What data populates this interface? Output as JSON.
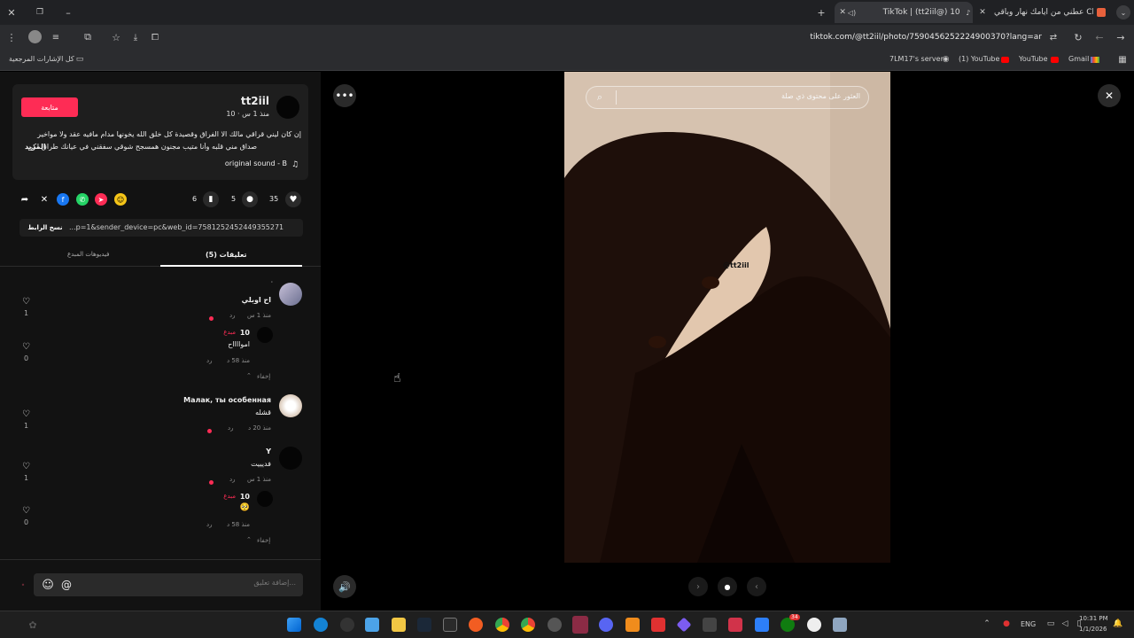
{
  "browser": {
    "tabs": [
      {
        "title": "عطني من أيامك نهار وباقي Cloud"
      },
      {
        "title": "TikTok | (tt2iil@) 10"
      }
    ],
    "url": "tiktok.com/@tt2iil/photo/7590456252224900370?lang=ar",
    "bookmarks": {
      "all_label": "كل الإشارات المرجعية",
      "items": [
        "7LM17's server",
        "(1) YouTube",
        "YouTube",
        "Gmail"
      ]
    }
  },
  "post": {
    "username": "tt2iil",
    "meta": "10 · منذ 1 س",
    "follow_label": "متابعة",
    "caption_line1": "إن كان ليني قراقي مالك الا الفراق وقصيدة كل خلق الله يخونها مدام مافيه عقد ولا مواخير",
    "caption_line2": "صداق مني قلبه وأنا متيب مجنون همسجح شوقي سفقني في عيانك طراق لكن لا...",
    "more_label": "المزيد",
    "sound": "original sound - B",
    "likes": "35",
    "comments": "5",
    "saves": "6",
    "copy_link_label": "نسخ الرابط",
    "link_text": "...p=1&sender_device=pc&web_id=7581252452449355271",
    "tab_comments": "(5) تعليقات",
    "tab_creator": "فيديوهات المبدع",
    "comment_placeholder": "إضافة تعليق..."
  },
  "comments": [
    {
      "name": "اح اوبلي",
      "mark": "٠",
      "time": "منذ 1 س",
      "reply": "رد",
      "likes": "1"
    },
    {
      "name": "10",
      "badge": "مبدع",
      "text": "اموااااح",
      "time": "منذ 58 د",
      "reply": "رد",
      "likes": "0"
    },
    {
      "hide": "إخفاء"
    },
    {
      "name": "Малак, ты особенная",
      "text": "قشله",
      "time": "منذ 20 د",
      "reply": "رد",
      "likes": "1"
    },
    {
      "name": "Y",
      "text": "فديييت",
      "time": "منذ 1 س",
      "reply": "رد",
      "likes": "1"
    },
    {
      "name": "10",
      "badge": "مبدع",
      "text": "🥺",
      "time": "منذ 58 د",
      "reply": "رد",
      "likes": "0"
    },
    {
      "hide": "إخفاء"
    }
  ],
  "viewer": {
    "search_placeholder": "العثور على محتوى ذي صلة",
    "watermark": "@tt2iil"
  },
  "taskbar": {
    "lang": "ENG",
    "time": "10:31 PM",
    "date": "1/1/2026",
    "badge": "34"
  },
  "colors": {
    "accent": "#fe2c55",
    "panel": "#121212",
    "photo_bg": "#d8c3b1"
  }
}
